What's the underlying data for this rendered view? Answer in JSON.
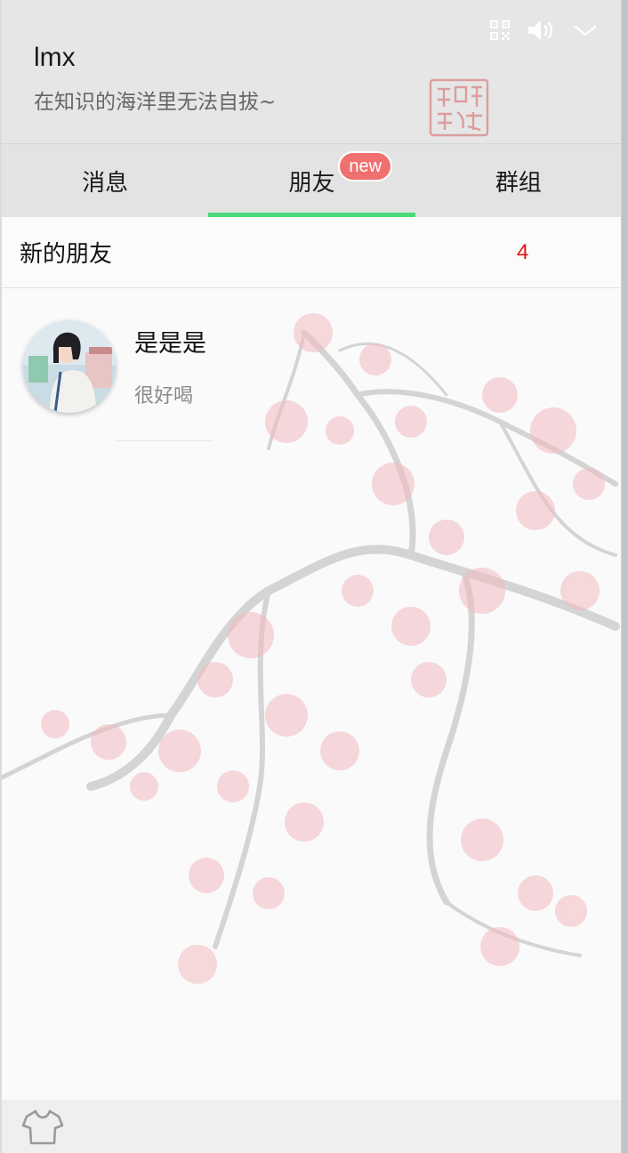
{
  "header": {
    "username": "lmx",
    "signature": "在知识的海洋里无法自拔~",
    "icons": [
      "qrcode-icon",
      "volume-icon",
      "chevron-down-icon"
    ]
  },
  "tabs": [
    {
      "label": "消息",
      "active": false
    },
    {
      "label": "朋友",
      "active": true,
      "badge": "new"
    },
    {
      "label": "群组",
      "active": false
    }
  ],
  "new_friends": {
    "label": "新的朋友",
    "count": "4"
  },
  "friends": [
    {
      "name": "是是是",
      "message": "很好喝"
    }
  ],
  "footer": {
    "icons": [
      "tshirt-icon"
    ]
  },
  "colors": {
    "accent": "#4cd97b",
    "badge": "#f07070",
    "count": "#e01515"
  }
}
